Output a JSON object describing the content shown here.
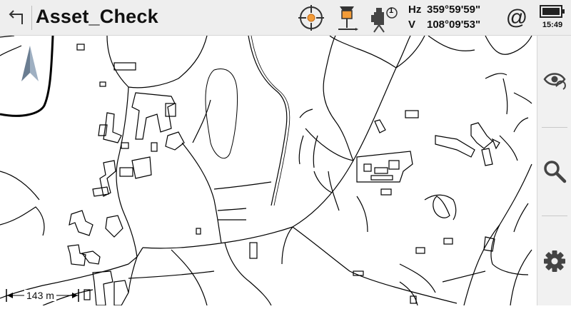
{
  "app": {
    "title": "Asset_Check"
  },
  "toolbar": {
    "back_icon": "back-arrow-icon",
    "target_icon": "crosshair-target-icon",
    "prism_icon": "prism-pole-icon",
    "instrument_icon": "total-station-icon",
    "instrument_badge": "1",
    "hz_label": "Hz",
    "hz_value": "359°59'59\"",
    "v_label": "V",
    "v_value": "108°09'53\"",
    "at_symbol": "@",
    "battery_icon": "battery-icon",
    "time": "15:49"
  },
  "map": {
    "scale_text": "143 m",
    "north_icon": "north-arrow-icon"
  },
  "sidebar": {
    "items": [
      {
        "name": "visibility-refresh-icon"
      },
      {
        "name": "search-icon"
      },
      {
        "name": "settings-gear-icon"
      }
    ]
  },
  "colors": {
    "toolbar_bg": "#eeeeee",
    "map_bg": "#ffffff",
    "lines": "#000000"
  }
}
